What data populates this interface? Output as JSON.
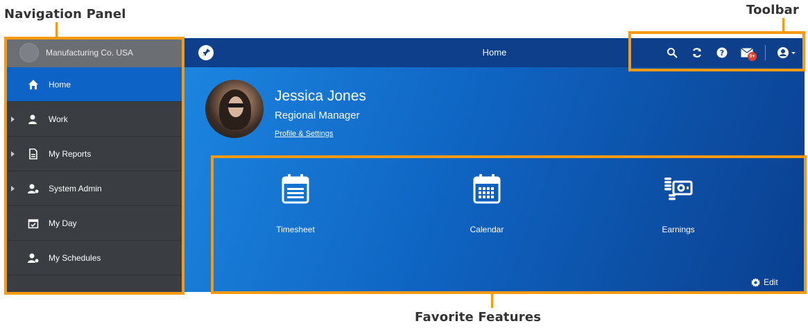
{
  "callouts": {
    "navigation_panel": "Navigation Panel",
    "toolbar": "Toolbar",
    "favorite_features": "Favorite Features"
  },
  "sidebar": {
    "org_name": "Manufacturing Co. USA",
    "items": [
      {
        "label": "Home",
        "icon": "home-icon",
        "active": true,
        "expandable": false
      },
      {
        "label": "Work",
        "icon": "user-icon",
        "active": false,
        "expandable": true
      },
      {
        "label": "My Reports",
        "icon": "report-icon",
        "active": false,
        "expandable": true
      },
      {
        "label": "System Admin",
        "icon": "user-gear-icon",
        "active": false,
        "expandable": true
      },
      {
        "label": "My Day",
        "icon": "calendar-check-icon",
        "active": false,
        "expandable": false
      },
      {
        "label": "My Schedules",
        "icon": "user-clock-icon",
        "active": false,
        "expandable": false
      }
    ]
  },
  "header": {
    "title": "Home",
    "mail_badge": "9+"
  },
  "user": {
    "name": "Jessica Jones",
    "role": "Regional Manager",
    "profile_link": "Profile & Settings"
  },
  "favorites": [
    {
      "label": "Timesheet",
      "icon": "timesheet-icon"
    },
    {
      "label": "Calendar",
      "icon": "calendar-icon"
    },
    {
      "label": "Earnings",
      "icon": "earnings-icon"
    }
  ],
  "edit_label": "Edit",
  "colors": {
    "accent_orange": "#f59a13",
    "sidebar_bg": "#3a3d42",
    "active_item": "#0e63c6",
    "topbar": "#0e3f8b"
  }
}
